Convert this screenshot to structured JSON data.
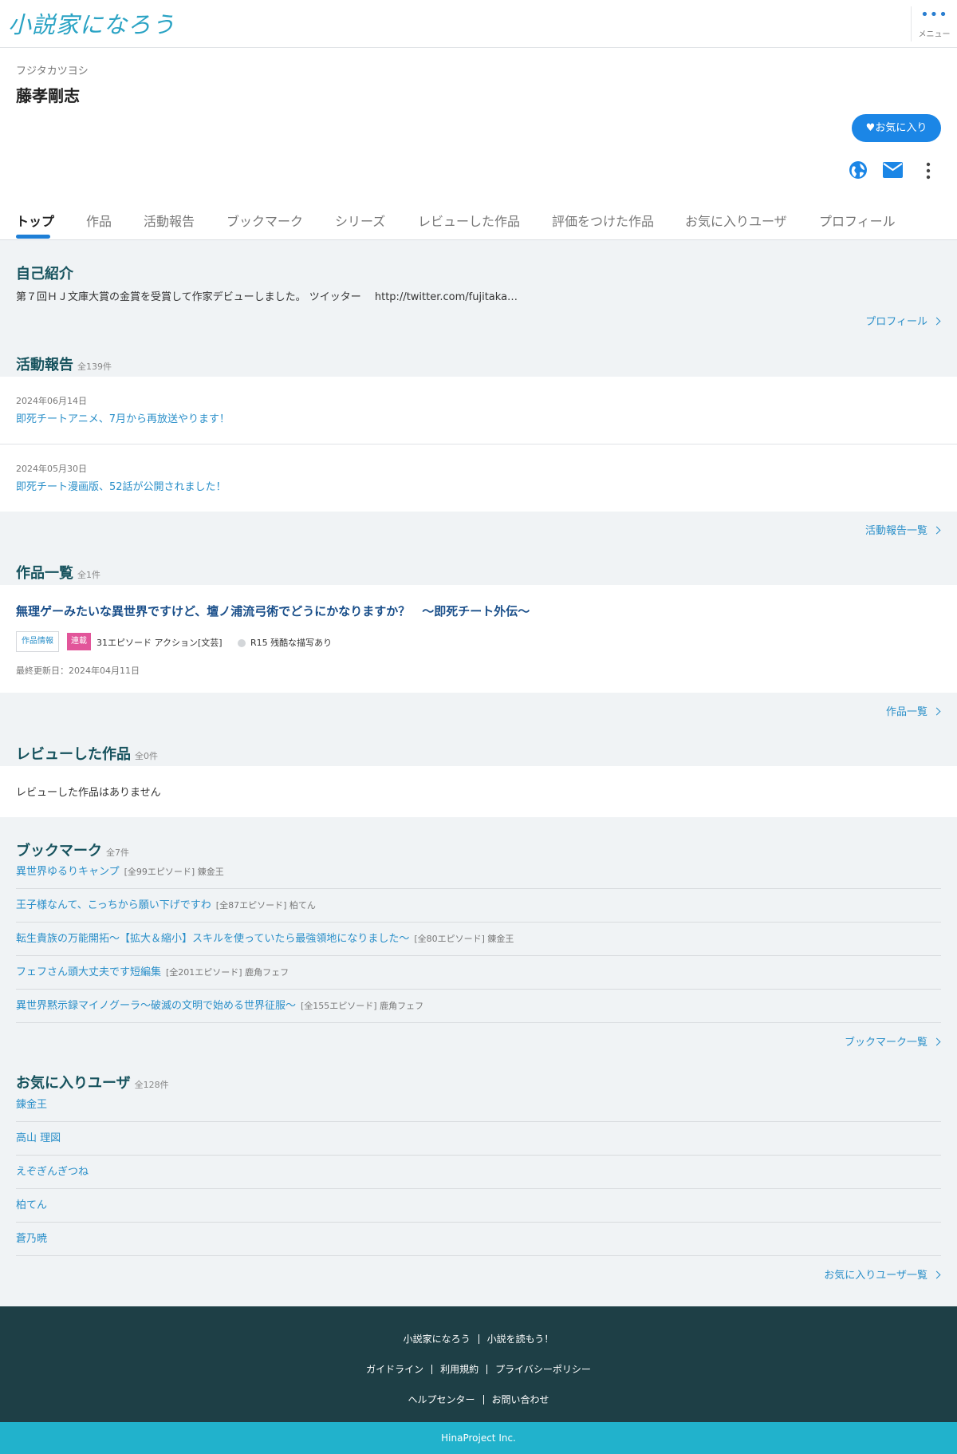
{
  "header": {
    "logo": "小説家になろう",
    "menu_dots": "•••",
    "menu_label": "メニュー"
  },
  "profile": {
    "kana": "フジタカツヨシ",
    "name": "藤孝剛志",
    "favorite_button": "お気に入り"
  },
  "tabs": [
    "トップ",
    "作品",
    "活動報告",
    "ブックマーク",
    "シリーズ",
    "レビューした作品",
    "評価をつけた作品",
    "お気に入りユーザ",
    "プロフィール"
  ],
  "intro": {
    "title": "自己紹介",
    "text": "第７回ＨＪ文庫大賞の金賞を受賞して作家デビューしました。 ツイッター　 http://twitter.com/fujitaka…",
    "more": "プロフィール"
  },
  "reports": {
    "title": "活動報告",
    "count": "全139件",
    "items": [
      {
        "date": "2024年06月14日",
        "title": "即死チートアニメ、7月から再放送やります！"
      },
      {
        "date": "2024年05月30日",
        "title": "即死チート漫画版、52話が公開されました！"
      }
    ],
    "more": "活動報告一覧"
  },
  "works": {
    "title": "作品一覧",
    "count": "全1件",
    "item": {
      "title": "無理ゲーみたいな異世界ですけど、壇ノ浦流弓術でどうにかなりますか？　～即死チート外伝～",
      "info_tag": "作品情報",
      "status_tag": "連載",
      "meta": "31エピソード アクション[文芸]",
      "warning": "R15 残酷な描写あり",
      "updated": "最終更新日：2024年04月11日"
    },
    "more": "作品一覧"
  },
  "reviews": {
    "title": "レビューした作品",
    "count": "全0件",
    "empty": "レビューした作品はありません"
  },
  "bookmarks": {
    "title": "ブックマーク",
    "count": "全7件",
    "items": [
      {
        "title": "異世界ゆるりキャンプ",
        "meta": "[全99エピソード] 錬金王"
      },
      {
        "title": "王子様なんて、こっちから願い下げですわ",
        "meta": "[全87エピソード] 柏てん"
      },
      {
        "title": "転生貴族の万能開拓～【拡大＆縮小】スキルを使っていたら最強領地になりました～",
        "meta": "[全80エピソード] 錬金王"
      },
      {
        "title": "フェフさん頭大丈夫です短編集",
        "meta": "[全201エピソード] 鹿角フェフ"
      },
      {
        "title": "異世界黙示録マイノグーラ～破滅の文明で始める世界征服～",
        "meta": "[全155エピソード] 鹿角フェフ"
      }
    ],
    "more": "ブックマーク一覧"
  },
  "fav_users": {
    "title": "お気に入りユーザ",
    "count": "全128件",
    "items": [
      "錬金王",
      "高山 理図",
      "えぞぎんぎつね",
      "柏てん",
      "蒼乃暁"
    ],
    "more": "お気に入りユーザ一覧"
  },
  "footer": {
    "links_1": [
      "小説家になろう",
      "小説を読もう！"
    ],
    "links_2": [
      "ガイドライン",
      "利用規約",
      "プライバシーポリシー"
    ],
    "links_3": [
      "ヘルプセンター",
      "お問い合わせ"
    ],
    "copyright": "HinaProject Inc."
  },
  "colors": {
    "accent": "#1b86e6",
    "link": "#2a8fc9",
    "heading": "#17535e",
    "footer_bg": "#1e3f46",
    "copyright_bg": "#21b2cc",
    "serial_tag": "#e2559a"
  }
}
